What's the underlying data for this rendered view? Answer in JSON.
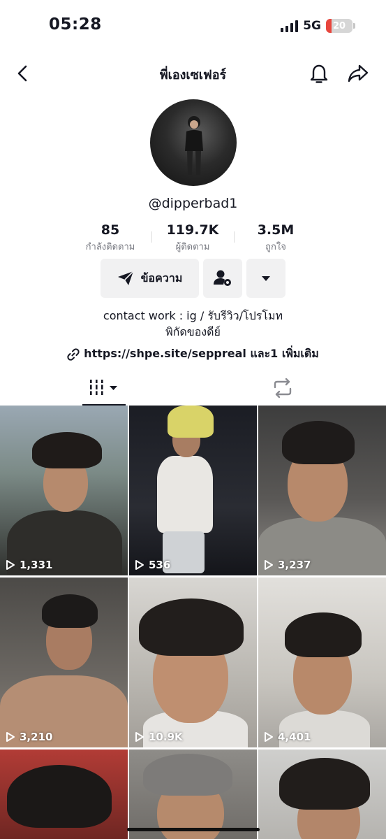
{
  "status_bar": {
    "time": "05:28",
    "network": "5G",
    "battery_level": "20",
    "battery_fraction": 0.2
  },
  "nav": {
    "title": "พี่เองเซเฟอร์",
    "icons": [
      "back-icon",
      "bell-icon",
      "share-icon"
    ]
  },
  "profile": {
    "username": "@dipperbad1",
    "stats": [
      {
        "value": "85",
        "label": "กำลังติดตาม"
      },
      {
        "value": "119.7K",
        "label": "ผู้ติดตาม"
      },
      {
        "value": "3.5M",
        "label": "ถูกใจ"
      }
    ],
    "message_button": "ข้อความ",
    "bio_line1": "contact work : ig /  รับรีวิว/โปรโมท",
    "bio_line2": "พิกัดของดีย์",
    "link": "https://shpe.site/seppreal และ1 เพิ่มเติม"
  },
  "tabs": [
    "videos-grid-tab",
    "repost-tab"
  ],
  "videos": [
    {
      "views": "1,331"
    },
    {
      "views": "536"
    },
    {
      "views": "3,237"
    },
    {
      "views": "3,210"
    },
    {
      "views": "10.9K"
    },
    {
      "views": "4,401"
    },
    {
      "views": ""
    },
    {
      "views": ""
    },
    {
      "views": ""
    }
  ],
  "colors": {
    "text": "#161823",
    "secondary_text": "#75777f",
    "button_bg": "#f1f1f2",
    "battery_low": "#e8463d"
  }
}
